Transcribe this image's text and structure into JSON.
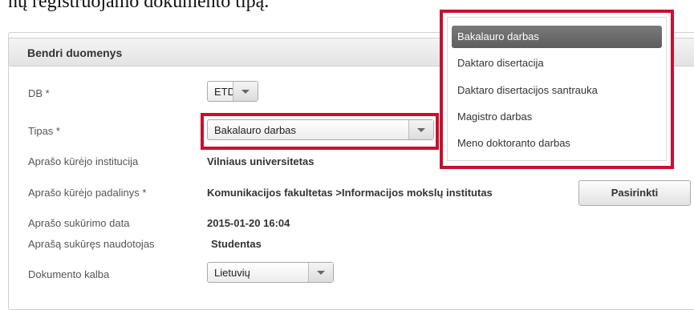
{
  "intro_text": "nų registruojamo dokumento tipą.",
  "panel": {
    "title": "Bendri duomenys"
  },
  "fields": {
    "db": {
      "label": "DB *",
      "value": "ETD"
    },
    "tipas": {
      "label": "Tipas *",
      "value": "Bakalauro darbas"
    },
    "institucija": {
      "label": "Aprašo kūrėjo institucija",
      "value": "Vilniaus universitetas"
    },
    "padalinys": {
      "label": "Aprašo kūrėjo padalinys *",
      "value": "Komunikacijos fakultetas >Informacijos mokslų institutas",
      "button": "Pasirinkti"
    },
    "data": {
      "label": "Aprašo sukūrimo data",
      "value": "2015-01-20 16:04"
    },
    "naudotojas": {
      "label": "Aprašą sukūręs naudotojas",
      "value": "Studentas"
    },
    "kalba": {
      "label": "Dokumento kalba",
      "value": "Lietuvių"
    }
  },
  "dropdown": {
    "options": [
      "Bakalauro darbas",
      "Daktaro disertacija",
      "Daktaro disertacijos santrauka",
      "Magistro darbas",
      "Meno doktoranto darbas"
    ],
    "selected_index": 0
  },
  "colors": {
    "highlight": "#c8102e",
    "selected_option_bg": "#6b6b6b"
  }
}
